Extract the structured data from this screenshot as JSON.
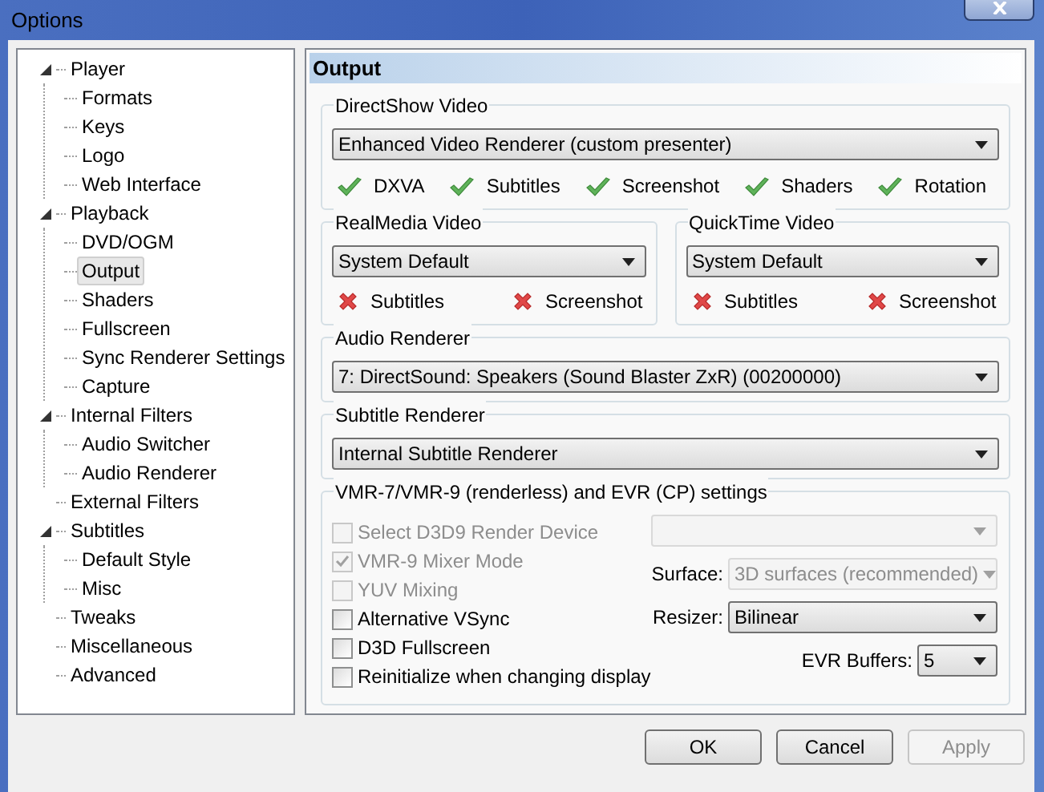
{
  "window": {
    "title": "Options"
  },
  "tree": [
    {
      "label": "Player",
      "selected": false,
      "expanded": true,
      "children": [
        {
          "label": "Formats",
          "selected": false
        },
        {
          "label": "Keys",
          "selected": false
        },
        {
          "label": "Logo",
          "selected": false
        },
        {
          "label": "Web Interface",
          "selected": false
        }
      ]
    },
    {
      "label": "Playback",
      "selected": false,
      "expanded": true,
      "children": [
        {
          "label": "DVD/OGM",
          "selected": false
        },
        {
          "label": "Output",
          "selected": true
        },
        {
          "label": "Shaders",
          "selected": false
        },
        {
          "label": "Fullscreen",
          "selected": false
        },
        {
          "label": "Sync Renderer Settings",
          "selected": false
        },
        {
          "label": "Capture",
          "selected": false
        }
      ]
    },
    {
      "label": "Internal Filters",
      "selected": false,
      "expanded": true,
      "children": [
        {
          "label": "Audio Switcher",
          "selected": false
        },
        {
          "label": "Audio Renderer",
          "selected": false
        }
      ]
    },
    {
      "label": "External Filters",
      "selected": false
    },
    {
      "label": "Subtitles",
      "selected": false,
      "expanded": true,
      "children": [
        {
          "label": "Default Style",
          "selected": false
        },
        {
          "label": "Misc",
          "selected": false
        }
      ]
    },
    {
      "label": "Tweaks",
      "selected": false
    },
    {
      "label": "Miscellaneous",
      "selected": false
    },
    {
      "label": "Advanced",
      "selected": false
    }
  ],
  "page": {
    "title": "Output"
  },
  "directshow": {
    "title": "DirectShow Video",
    "value": "Enhanced Video Renderer (custom presenter)",
    "features": [
      {
        "label": "DXVA",
        "supported": true
      },
      {
        "label": "Subtitles",
        "supported": true
      },
      {
        "label": "Screenshot",
        "supported": true
      },
      {
        "label": "Shaders",
        "supported": true
      },
      {
        "label": "Rotation",
        "supported": true
      }
    ]
  },
  "realmedia": {
    "title": "RealMedia Video",
    "value": "System Default",
    "features": [
      {
        "label": "Subtitles",
        "supported": false
      },
      {
        "label": "Screenshot",
        "supported": false
      }
    ]
  },
  "quicktime": {
    "title": "QuickTime Video",
    "value": "System Default",
    "features": [
      {
        "label": "Subtitles",
        "supported": false
      },
      {
        "label": "Screenshot",
        "supported": false
      }
    ]
  },
  "audio_renderer": {
    "title": "Audio Renderer",
    "value": "7: DirectSound: Speakers (Sound Blaster ZxR) (00200000)"
  },
  "subtitle_renderer": {
    "title": "Subtitle Renderer",
    "value": "Internal Subtitle Renderer"
  },
  "vmr_settings": {
    "title": "VMR-7/VMR-9 (renderless) and EVR (CP) settings",
    "options": [
      {
        "label": "Select D3D9 Render Device",
        "checked": false,
        "disabled": true
      },
      {
        "label": "VMR-9 Mixer Mode",
        "checked": true,
        "disabled": true
      },
      {
        "label": "YUV Mixing",
        "checked": false,
        "disabled": true
      },
      {
        "label": "Alternative VSync",
        "checked": false,
        "disabled": false
      },
      {
        "label": "D3D Fullscreen",
        "checked": false,
        "disabled": false
      },
      {
        "label": "Reinitialize when changing display",
        "checked": false,
        "disabled": false
      }
    ],
    "selects": [
      {
        "disabled": true
      },
      {
        "label": "Surface:",
        "value": "3D surfaces (recommended)",
        "disabled": true
      },
      {
        "label": "Resizer:",
        "value": "Bilinear",
        "disabled": false
      },
      {
        "label": "EVR Buffers:",
        "value": "5",
        "disabled": false
      }
    ]
  },
  "buttons": [
    {
      "label": "OK",
      "disabled": false
    },
    {
      "label": "Cancel",
      "disabled": false
    },
    {
      "label": "Apply",
      "disabled": true
    }
  ]
}
